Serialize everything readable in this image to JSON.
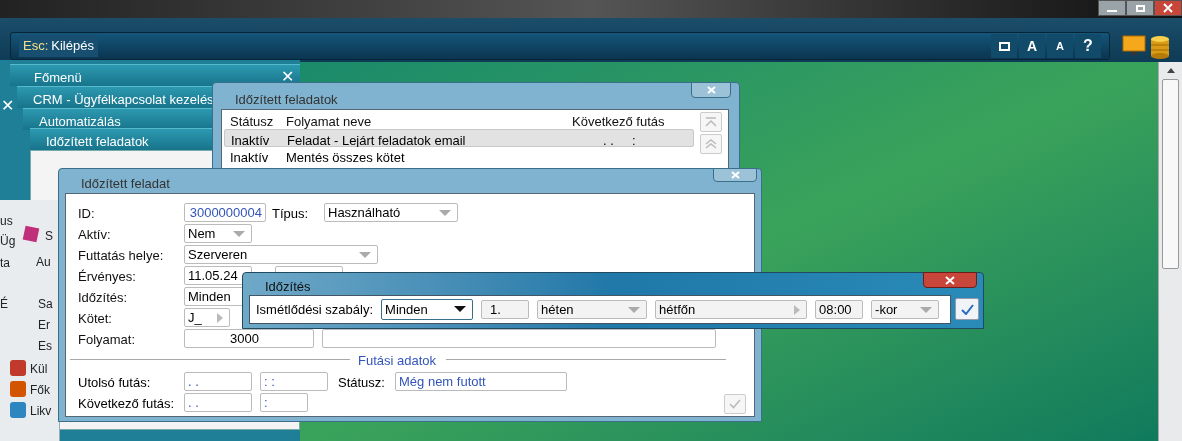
{
  "toolbar": {
    "key": "Esc:",
    "label": "Kilépés",
    "buttons": [
      {
        "kind": "window"
      },
      {
        "kind": "font-large",
        "label": "A"
      },
      {
        "kind": "font-small",
        "label": "A"
      },
      {
        "kind": "help",
        "label": "?"
      }
    ]
  },
  "menu_stack": {
    "headers": [
      {
        "title": "Főmenü",
        "close": "✕"
      },
      {
        "title": "CRM - Ügyfélkapcsolat kezelés",
        "close": "✕"
      },
      {
        "title": "Automatizálás"
      },
      {
        "title": "Időzített feladatok"
      }
    ],
    "fragments": [
      "us",
      "Üg",
      "ta",
      "É",
      "S",
      "Au",
      "Sa",
      "Er",
      "Es"
    ],
    "menu_items": [
      {
        "label": "Kül"
      },
      {
        "label": "Fők"
      },
      {
        "label": "Likv"
      }
    ]
  },
  "list_window": {
    "title": "Időzített feladatok",
    "columns": [
      "Státusz",
      "Folyamat neve",
      "Következő futás"
    ],
    "rows": [
      {
        "status": "Inaktív",
        "name": "Feladat - Lejárt feladatok email",
        "next": ". .     :",
        "selected": true
      },
      {
        "status": "Inaktív",
        "name": "Mentés összes kötet",
        "next": "",
        "selected": false
      }
    ]
  },
  "task_window": {
    "title": "Időzített feladat",
    "fields": [
      {
        "label": "ID:",
        "value": "3000000004",
        "kind": "id",
        "extra_label": "Típus:",
        "extra_value": "Használható"
      },
      {
        "label": "Aktív:",
        "value": "Nem",
        "kind": "dropdown"
      },
      {
        "label": "Futtatás helye:",
        "value": "Szerveren",
        "kind": "wide-dropdown"
      },
      {
        "label": "Érvényes:",
        "value": "11.05.24",
        "kind": "date"
      },
      {
        "label": "Időzítés:",
        "value": "Minden",
        "kind": "text"
      },
      {
        "label": "Kötet:",
        "value": "J_",
        "kind": "spin"
      },
      {
        "label": "Folyamat:",
        "value": "3000",
        "kind": "process"
      }
    ],
    "section": "Futási adatok",
    "last_run": {
      "label": "Utolsó futás:",
      "date": ". .",
      "time": ": :",
      "status_label": "Státusz:",
      "status": "Még nem futott"
    },
    "next_run": {
      "label": "Következő futás:",
      "date": ". .",
      "time": ":"
    },
    "ok_disabled": true
  },
  "timing_dialog": {
    "title": "Időzítés",
    "rule_label": "Ismétlődési szabály:",
    "rule": "Minden",
    "number": "1.",
    "unit": "héten",
    "day": "hétfőn",
    "time": "08:00",
    "suffix": "-kor"
  }
}
